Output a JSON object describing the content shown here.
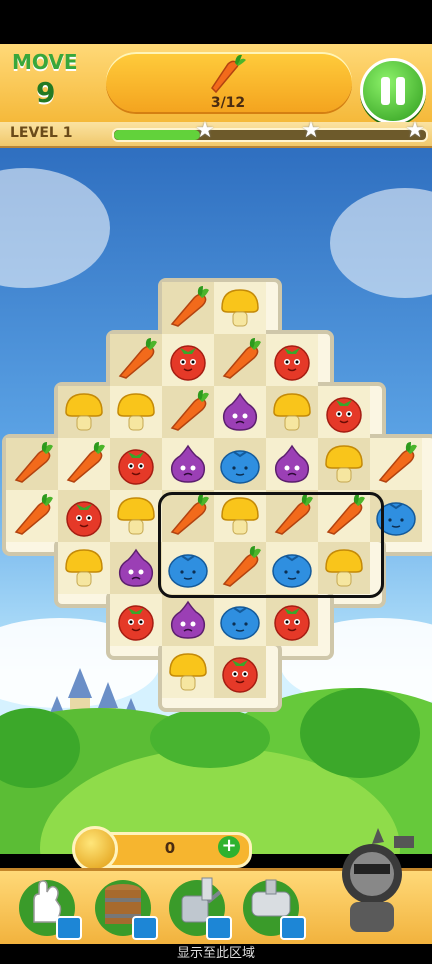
{
  "header": {
    "moves_label": "MOVE",
    "moves_value": "9",
    "goal_count": "3/12",
    "goal_icon": "carrot-icon",
    "pause_icon": "pause-icon"
  },
  "level": {
    "label": "LEVEL",
    "number": "1",
    "progress_fraction": 0.28,
    "stars": 3
  },
  "board": {
    "columns": 8,
    "rows": 8,
    "cells": [
      [
        null,
        null,
        null,
        "carrot",
        "mushroom",
        null,
        null,
        null
      ],
      [
        null,
        null,
        "carrot",
        "tomato",
        "carrot",
        "tomato",
        null,
        null
      ],
      [
        null,
        "mushroom",
        "mushroom",
        "carrot",
        "onion",
        "mushroom",
        "tomato",
        null
      ],
      [
        "carrot",
        "carrot",
        "tomato",
        "onion",
        "blueberry",
        "onion",
        "mushroom",
        "carrot"
      ],
      [
        "carrot",
        "tomato",
        "mushroom",
        "carrot",
        "mushroom",
        "carrot",
        "carrot",
        "blueberry"
      ],
      [
        null,
        "mushroom",
        "onion",
        "blueberry",
        "carrot",
        "blueberry",
        "mushroom",
        null
      ],
      [
        null,
        null,
        "tomato",
        "onion",
        "blueberry",
        "tomato",
        null,
        null
      ],
      [
        null,
        null,
        null,
        "mushroom",
        "tomato",
        null,
        null,
        null
      ]
    ],
    "highlight": "hint-region"
  },
  "coins": {
    "value": "0",
    "add_label": "+"
  },
  "tools": [
    {
      "name": "glove",
      "icon": "glove-icon",
      "locked": true
    },
    {
      "name": "barrel",
      "icon": "barrel-icon",
      "locked": true
    },
    {
      "name": "watering-can",
      "icon": "watering-can-icon",
      "locked": true
    },
    {
      "name": "roller",
      "icon": "roller-icon",
      "locked": true
    }
  ],
  "knight_icon": "knight-icon",
  "footer_text": "显示至此区域",
  "colors": {
    "carrot": "#f26a1b",
    "tomato": "#e53928",
    "mushroom": "#f9c51b",
    "onion": "#9b3fb5",
    "blueberry": "#2f8fe0"
  }
}
